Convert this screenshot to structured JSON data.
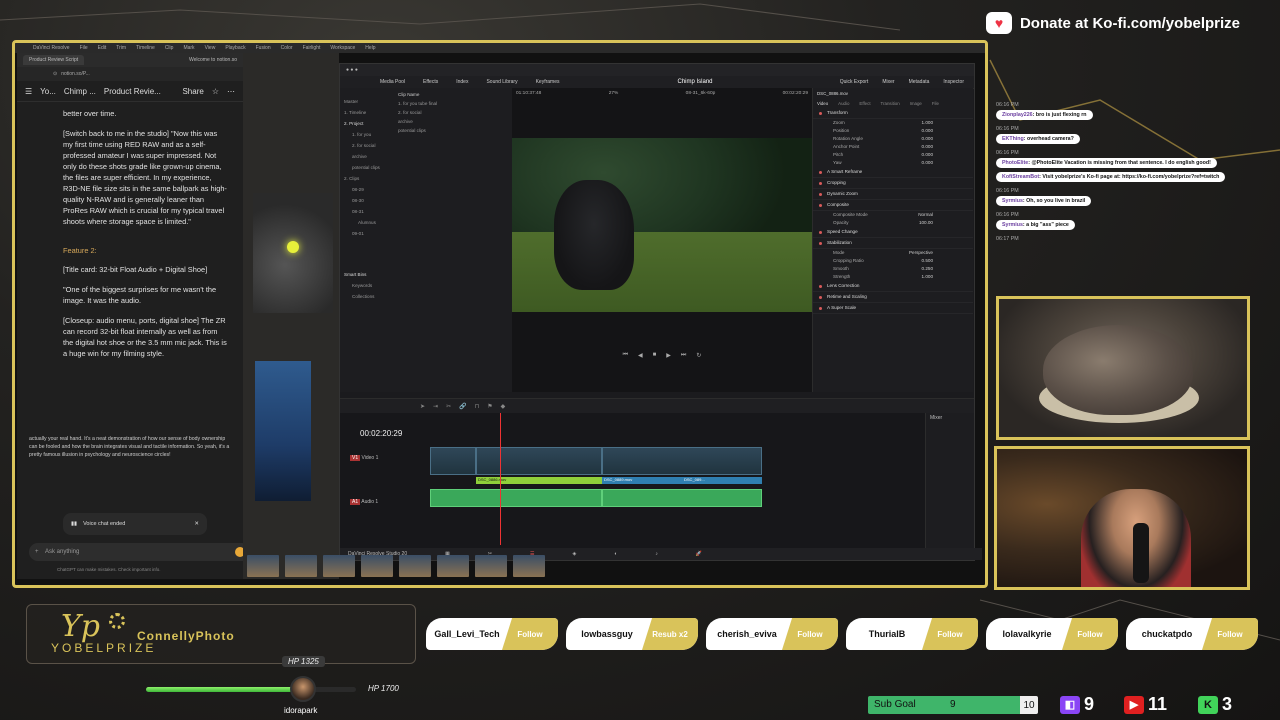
{
  "donate": {
    "text": "Donate at Ko-fi.com/yobelprize",
    "icon": "kofi-cup-icon"
  },
  "browser": {
    "tabs": [
      "Product Review Script",
      "Welcome to notion.so"
    ],
    "url": "notion.so/P...",
    "nav": [
      "Yo...",
      "Chimp ...",
      "Product Revie..."
    ],
    "share": "Share",
    "paragraphs": [
      "better over time.",
      "[Switch back to me in the studio] \"Now this was my first time using RED RAW and as a self-professed amateur I was super impressed. Not only do these shots grade like grown-up cinema, the files are super efficient. In my experience, R3D-NE file size sits in the same ballpark as high-quality N-RAW and is generally leaner than ProRes RAW which is crucial for my typical travel shoots where storage space is limited.\"",
      "Feature 2:",
      "[Title card: 32-bit Float Audio + Digital Shoe]",
      "\"One of the biggest surprises for me wasn't the image. It was the audio.",
      "[Closeup: audio menu, ports, digital shoe] The ZR can record 32-bit float internally as well as from the digital hot shoe or the 3.5 mm mic jack. This is a huge win for my filming style."
    ],
    "chat_overlay": "actually your real hand. It's a neat demonstration of how our sense of body ownership can be fooled and how the brain integrates visual and tactile information. So yeah, it's a pretty famous illusion in psychology and neuroscience circles!",
    "voice_chat": "Voice chat ended",
    "voice_sub": "6s",
    "ask_placeholder": "Ask anything",
    "disclaimer": "ChatGPT can make mistakes. Check important info."
  },
  "resolve": {
    "tabs": [
      "Media Pool",
      "Effects",
      "Index",
      "Sound Library",
      "Keyframes"
    ],
    "project": "Chimp Island",
    "right_tabs": [
      "Quick Export",
      "Mixer",
      "Metadata",
      "Inspector"
    ],
    "timecode_in": "01:10:37:48",
    "zoom": "27%",
    "clip_range": "08-31_6k-60p",
    "viewer_tc": "00:02:20:29",
    "clip_name": "DSC_0886.mov",
    "bins": [
      "Master",
      "1. Timeline",
      "2. Project",
      "1. for you",
      "2. for social",
      "archive",
      "potential clips",
      "2. Clips",
      "08-29",
      "08-30",
      "08-31",
      "Alumnus",
      "09-01"
    ],
    "clips_header": "Clip Name",
    "clips": [
      "1. for you tube final",
      "2. for social",
      "archive",
      "potential clips"
    ],
    "smart_bins": [
      "Smart Bins",
      "Keywords",
      "Collections"
    ],
    "inspector_tabs": [
      "Video",
      "Audio",
      "Effect",
      "Transition",
      "Image",
      "File"
    ],
    "inspector_sections": [
      "Transform",
      "A Smart Reframe",
      "Cropping",
      "Dynamic Zoom",
      "Composite",
      "Speed Change",
      "Stabilization",
      "Lens Correction",
      "Retime and Scaling",
      "A Super Scale"
    ],
    "transform": [
      {
        "label": "Zoom",
        "value": "1.000"
      },
      {
        "label": "Position",
        "value": "0.000"
      },
      {
        "label": "Rotation Angle",
        "value": "0.000"
      },
      {
        "label": "Anchor Point",
        "value": "0.000"
      },
      {
        "label": "Pitch",
        "value": "0.000"
      },
      {
        "label": "Yaw",
        "value": "0.000"
      }
    ],
    "composite_mode": "Normal",
    "opacity": "100.00",
    "stabilization": {
      "mode": "Perspective",
      "ratio": "0.500",
      "smooth": "0.250",
      "strength": "1.000"
    },
    "timeline_tc": "00:02:20:29",
    "tracks": [
      "Video 1",
      "Audio 1"
    ],
    "track_ids": [
      "V1",
      "A1"
    ],
    "clip_labels": [
      "DSC_0886.mov",
      "DSC_0889.mov",
      "DSC_089..."
    ],
    "mixer": "Mixer",
    "footer": "DaVinci Resolve Studio 20"
  },
  "chat": [
    {
      "time": "06:16 PM",
      "user": "Zionplay226",
      "text": "bro is just flexing rn"
    },
    {
      "time": "06:16 PM",
      "user": "EKThing",
      "text": "overhead camera?"
    },
    {
      "time": "06:16 PM",
      "user": "PhotoElite",
      "text": "@PhotoElite Vacation is missing from that sentence. I do english good!"
    },
    {
      "time": "",
      "user": "KofiStreamBot",
      "text": "Visit yobelprize's Ko-fi page at: https://ko-fi.com/yobelprize?ref=twitch"
    },
    {
      "time": "06:16 PM",
      "user": "Syrmius",
      "text": "Oh, so you live in brazil"
    },
    {
      "time": "06:16 PM",
      "user": "Syrmius",
      "text": "a big \"ass\" piece"
    },
    {
      "time": "06:17 PM",
      "user": "",
      "text": ""
    }
  ],
  "logo": {
    "brand": "YOBELPRIZE",
    "channel": "ConnellyPhoto"
  },
  "follows": [
    {
      "name": "Gall_Levi_Tech",
      "tag": "Follow"
    },
    {
      "name": "lowbassguy",
      "tag": "Resub x2"
    },
    {
      "name": "cherish_eviva",
      "tag": "Follow"
    },
    {
      "name": "ThurialB",
      "tag": "Follow"
    },
    {
      "name": "lolavalkyrie",
      "tag": "Follow"
    },
    {
      "name": "chuckatpdo",
      "tag": "Follow"
    }
  ],
  "hp": {
    "top": "HP 1325",
    "right": "HP 1700",
    "fraction": 0.78,
    "user": "idorapark"
  },
  "subgoal": {
    "label": "Sub Goal",
    "current": "9",
    "goal": "10",
    "fraction": 0.9
  },
  "platforms": [
    {
      "name": "twitch",
      "count": "9",
      "color": "#8a45f5"
    },
    {
      "name": "youtube",
      "count": "11",
      "color": "#e02020"
    },
    {
      "name": "kick",
      "count": "3",
      "color": "#41d35a"
    }
  ]
}
